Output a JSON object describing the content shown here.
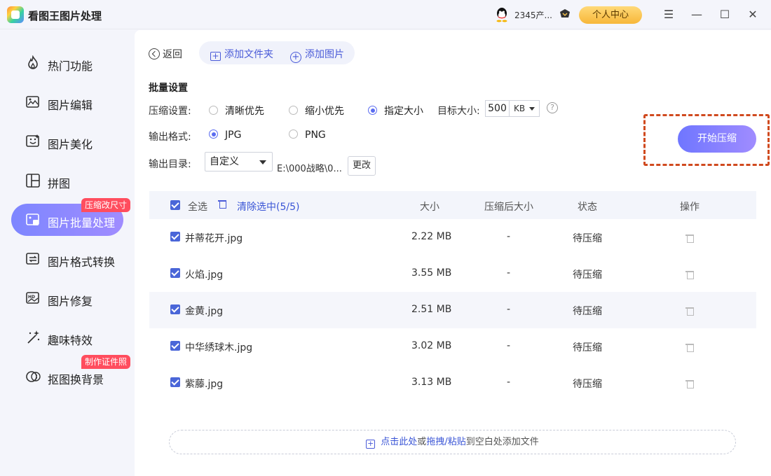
{
  "app": {
    "title": "看图王图片处理",
    "user": "2345产...",
    "center_label": "个人中心"
  },
  "sidebar": {
    "items": [
      {
        "label": "热门功能",
        "icon": "flame-icon"
      },
      {
        "label": "图片编辑",
        "icon": "image-edit-icon"
      },
      {
        "label": "图片美化",
        "icon": "image-beautify-icon"
      },
      {
        "label": "拼图",
        "icon": "collage-icon"
      },
      {
        "label": "图片批量处理",
        "icon": "batch-image-icon",
        "badge": "压缩改尺寸"
      },
      {
        "label": "图片格式转换",
        "icon": "format-convert-icon"
      },
      {
        "label": "图片修复",
        "icon": "hd-repair-icon"
      },
      {
        "label": "趣味特效",
        "icon": "magic-wand-icon"
      },
      {
        "label": "抠图换背景",
        "icon": "cutout-icon",
        "badge": "制作证件照"
      }
    ]
  },
  "toolbar": {
    "back_label": "返回",
    "add_folder_label": "添加文件夹",
    "add_image_label": "添加图片"
  },
  "settings": {
    "title": "批量设置",
    "compress_label": "压缩设置:",
    "compress_options": [
      "清晰优先",
      "缩小优先",
      "指定大小"
    ],
    "target_label": "目标大小:",
    "target_value": "500",
    "target_unit": "KB",
    "format_label": "输出格式:",
    "format_options": [
      "JPG",
      "PNG"
    ],
    "dir_label": "输出目录:",
    "dir_option": "自定义",
    "dir_path": "E:\\000战略\\0...",
    "change_label": "更改",
    "start_label": "开始压缩"
  },
  "table": {
    "select_all": "全选",
    "clear_label": "清除选中(5/5)",
    "columns": [
      "大小",
      "压缩后大小",
      "状态",
      "操作"
    ],
    "rows": [
      {
        "name": "并蒂花开.jpg",
        "size": "2.22 MB",
        "after": "-",
        "status": "待压缩"
      },
      {
        "name": "火焰.jpg",
        "size": "3.55 MB",
        "after": "-",
        "status": "待压缩"
      },
      {
        "name": "金黄.jpg",
        "size": "2.51 MB",
        "after": "-",
        "status": "待压缩"
      },
      {
        "name": "中华绣球木.jpg",
        "size": "3.02 MB",
        "after": "-",
        "status": "待压缩"
      },
      {
        "name": "紫藤.jpg",
        "size": "3.13 MB",
        "after": "-",
        "status": "待压缩"
      }
    ]
  },
  "dropzone": {
    "part1": "点击此处",
    "part2": "或",
    "part3": "拖拽/粘贴",
    "part4": "到空白处添加文件"
  },
  "colors": {
    "accent": "#6f76ff",
    "checkbox": "#4a66d8",
    "badge": "#ff4d5e",
    "highlight": "#d04a1f"
  }
}
